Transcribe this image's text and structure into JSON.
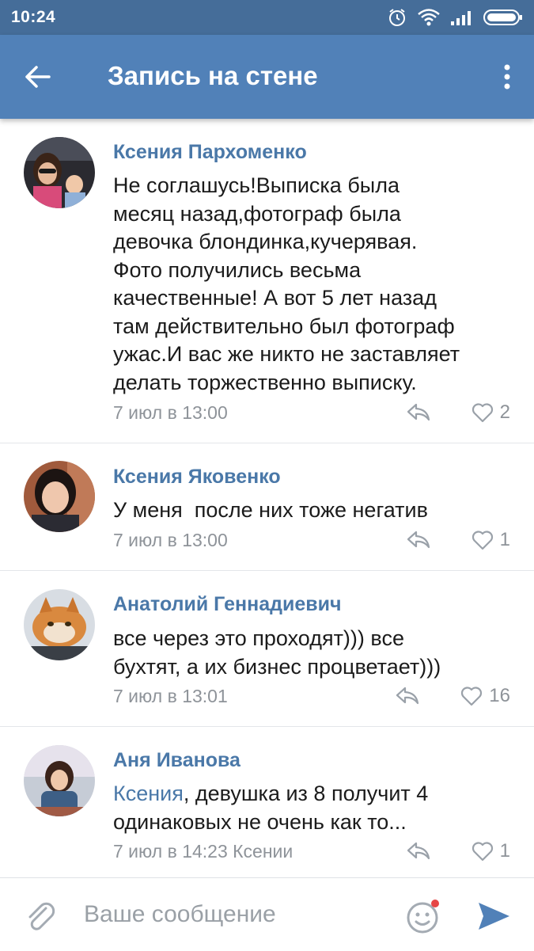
{
  "status_bar": {
    "time": "10:24",
    "icons": [
      "alarm-icon",
      "wifi-icon",
      "signal-icon",
      "battery-icon"
    ]
  },
  "toolbar": {
    "title": "Запись на стене",
    "back_icon": "arrow-left-icon",
    "menu_icon": "more-vertical-icon"
  },
  "colors": {
    "status_bar": "#456d99",
    "toolbar": "#5181b8",
    "link": "#4a78a8",
    "text": "#1b1b1b",
    "meta": "#8e9399",
    "send": "#5181b8",
    "notification_dot": "#e64646"
  },
  "comments": [
    {
      "author": "Ксения Пархоменко",
      "text_lines": [
        "Не соглашусь!Выписка была",
        "месяц назад,фотограф была",
        "девочка блондинка,кучерявая.",
        "Фото получились весьма",
        "качественные! А вот 5 лет назад",
        "там действительно был фотограф",
        "ужас.И вас же никто не заставляет",
        "делать торжественно выписку."
      ],
      "date": "7 июл в 13:00",
      "likes": "2"
    },
    {
      "author": "Ксения Яковенко",
      "text_lines": [
        "У меня  после них тоже негатив"
      ],
      "date": "7 июл в 13:00",
      "likes": "1"
    },
    {
      "author": "Анатолий Геннадиевич",
      "text_lines": [
        "все через это проходят))) все",
        "бухтят, а их бизнес процветает)))"
      ],
      "date": "7 июл в 13:01",
      "likes": "16"
    },
    {
      "author": "Аня Иванова",
      "mention": "Ксения",
      "text_lines": [
        ", девушка из 8 получит 4",
        "одинаковых не очень как то..."
      ],
      "date": "7 июл в 14:23 Ксении",
      "likes": "1"
    }
  ],
  "input_bar": {
    "placeholder": "Ваше сообщение",
    "attach_icon": "paperclip-icon",
    "emoji_icon": "smile-icon",
    "send_icon": "send-icon"
  }
}
